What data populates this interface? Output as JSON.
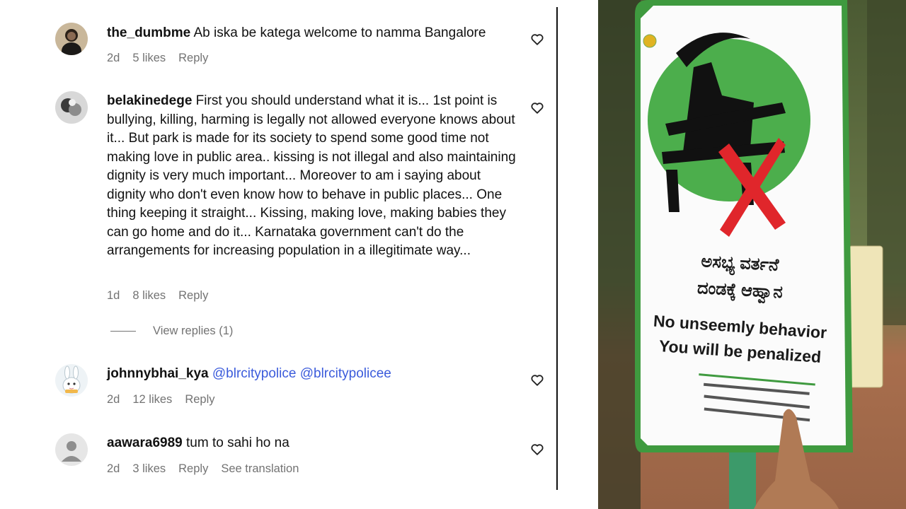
{
  "comments": [
    {
      "username": "the_dumbme",
      "text": "Ab iska be katega welcome to namma Bangalore",
      "time": "2d",
      "likes": "5 likes",
      "reply": "Reply"
    },
    {
      "username": "belakinedege",
      "text": "First you should understand what it is... 1st point is bullying, killing, harming is legally not allowed everyone knows about it... But park is made for its society to spend some good time not making love in public area.. kissing is not illegal and also maintaining dignity is very much important... Moreover to am i saying about dignity who don't even know how to behave in public places... One thing keeping it straight... Kissing, making love, making babies they can go home and do it... Karnataka government can't do the arrangements for increasing population in a illegitimate way...",
      "time": "1d",
      "likes": "8 likes",
      "reply": "Reply"
    },
    {
      "username": "johnnybhai_kya",
      "mention1": "@blrcitypolice",
      "mention2": "@blrcitypolicee",
      "time": "2d",
      "likes": "12 likes",
      "reply": "Reply"
    },
    {
      "username": "aawara6989",
      "text": "tum to sahi ho na",
      "time": "2d",
      "likes": "3 likes",
      "reply": "Reply",
      "translate": "See translation"
    }
  ],
  "view_replies": "View replies (1)",
  "sign": {
    "kannada_line1": "ಅಸಭ್ಯ ವರ್ತನೆ",
    "kannada_line2": "ದಂಡಕ್ಕೆ ಆಹ್ವಾನ",
    "english_line1": "No unseemly behavior",
    "english_line2": "You will be penalized",
    "sign_green": "#4cae4c",
    "cross_red": "#e0262b"
  },
  "colors": {
    "text": "#111111",
    "meta": "#737373",
    "mention": "#3b5bdb"
  }
}
